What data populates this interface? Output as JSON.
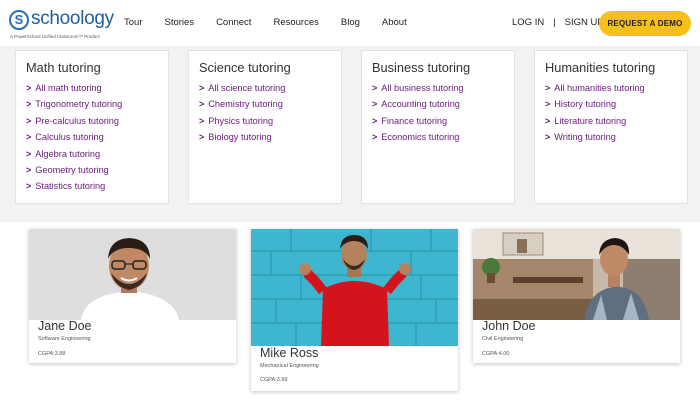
{
  "header": {
    "logo_text": "schoology",
    "logo_mark": "S",
    "logo_tagline": "A PowerSchool Unified Classroom™ Product",
    "nav": [
      "Tour",
      "Stories",
      "Connect",
      "Resources",
      "Blog",
      "About"
    ],
    "login": "LOG IN",
    "divider": "|",
    "signup": "SIGN UP",
    "demo_button": "REQUEST A DEMO"
  },
  "tutoring": [
    {
      "title": "Math tutoring",
      "links": [
        "All math tutoring",
        "Trigonometry tutoring",
        "Pre-calculus tutoring",
        "Calculus tutoring",
        "Algebra tutoring",
        "Geometry tutoring",
        "Statistics tutoring"
      ]
    },
    {
      "title": "Science tutoring",
      "links": [
        "All science tutoring",
        "Chemistry tutoring",
        "Physics tutoring",
        "Biology tutoring"
      ]
    },
    {
      "title": "Business tutoring",
      "links": [
        "All business tutoring",
        "Accounting tutoring",
        "Finance tutoring",
        "Economics tutoring"
      ]
    },
    {
      "title": "Humanities tutoring",
      "links": [
        "All humanities tutoring",
        "History tutoring",
        "Literature tutoring",
        "Writing tutoring"
      ]
    }
  ],
  "link_chevron": ">",
  "profiles": [
    {
      "name": "Jane Doe",
      "field": "Software Engineering",
      "cgpa": "CGPA:3.88"
    },
    {
      "name": "Mike Ross",
      "field": "Mechanical Engineering",
      "cgpa": "CGPA:3.99"
    },
    {
      "name": "John Doe",
      "field": "Civil Engineering",
      "cgpa": "CGPA:4.00"
    }
  ],
  "colors": {
    "accent": "#f7c019",
    "link": "#6a1a7a",
    "brand": "#1f5f9e"
  },
  "icons": [
    "schoology-logo-icon",
    "chevron-right-icon"
  ]
}
